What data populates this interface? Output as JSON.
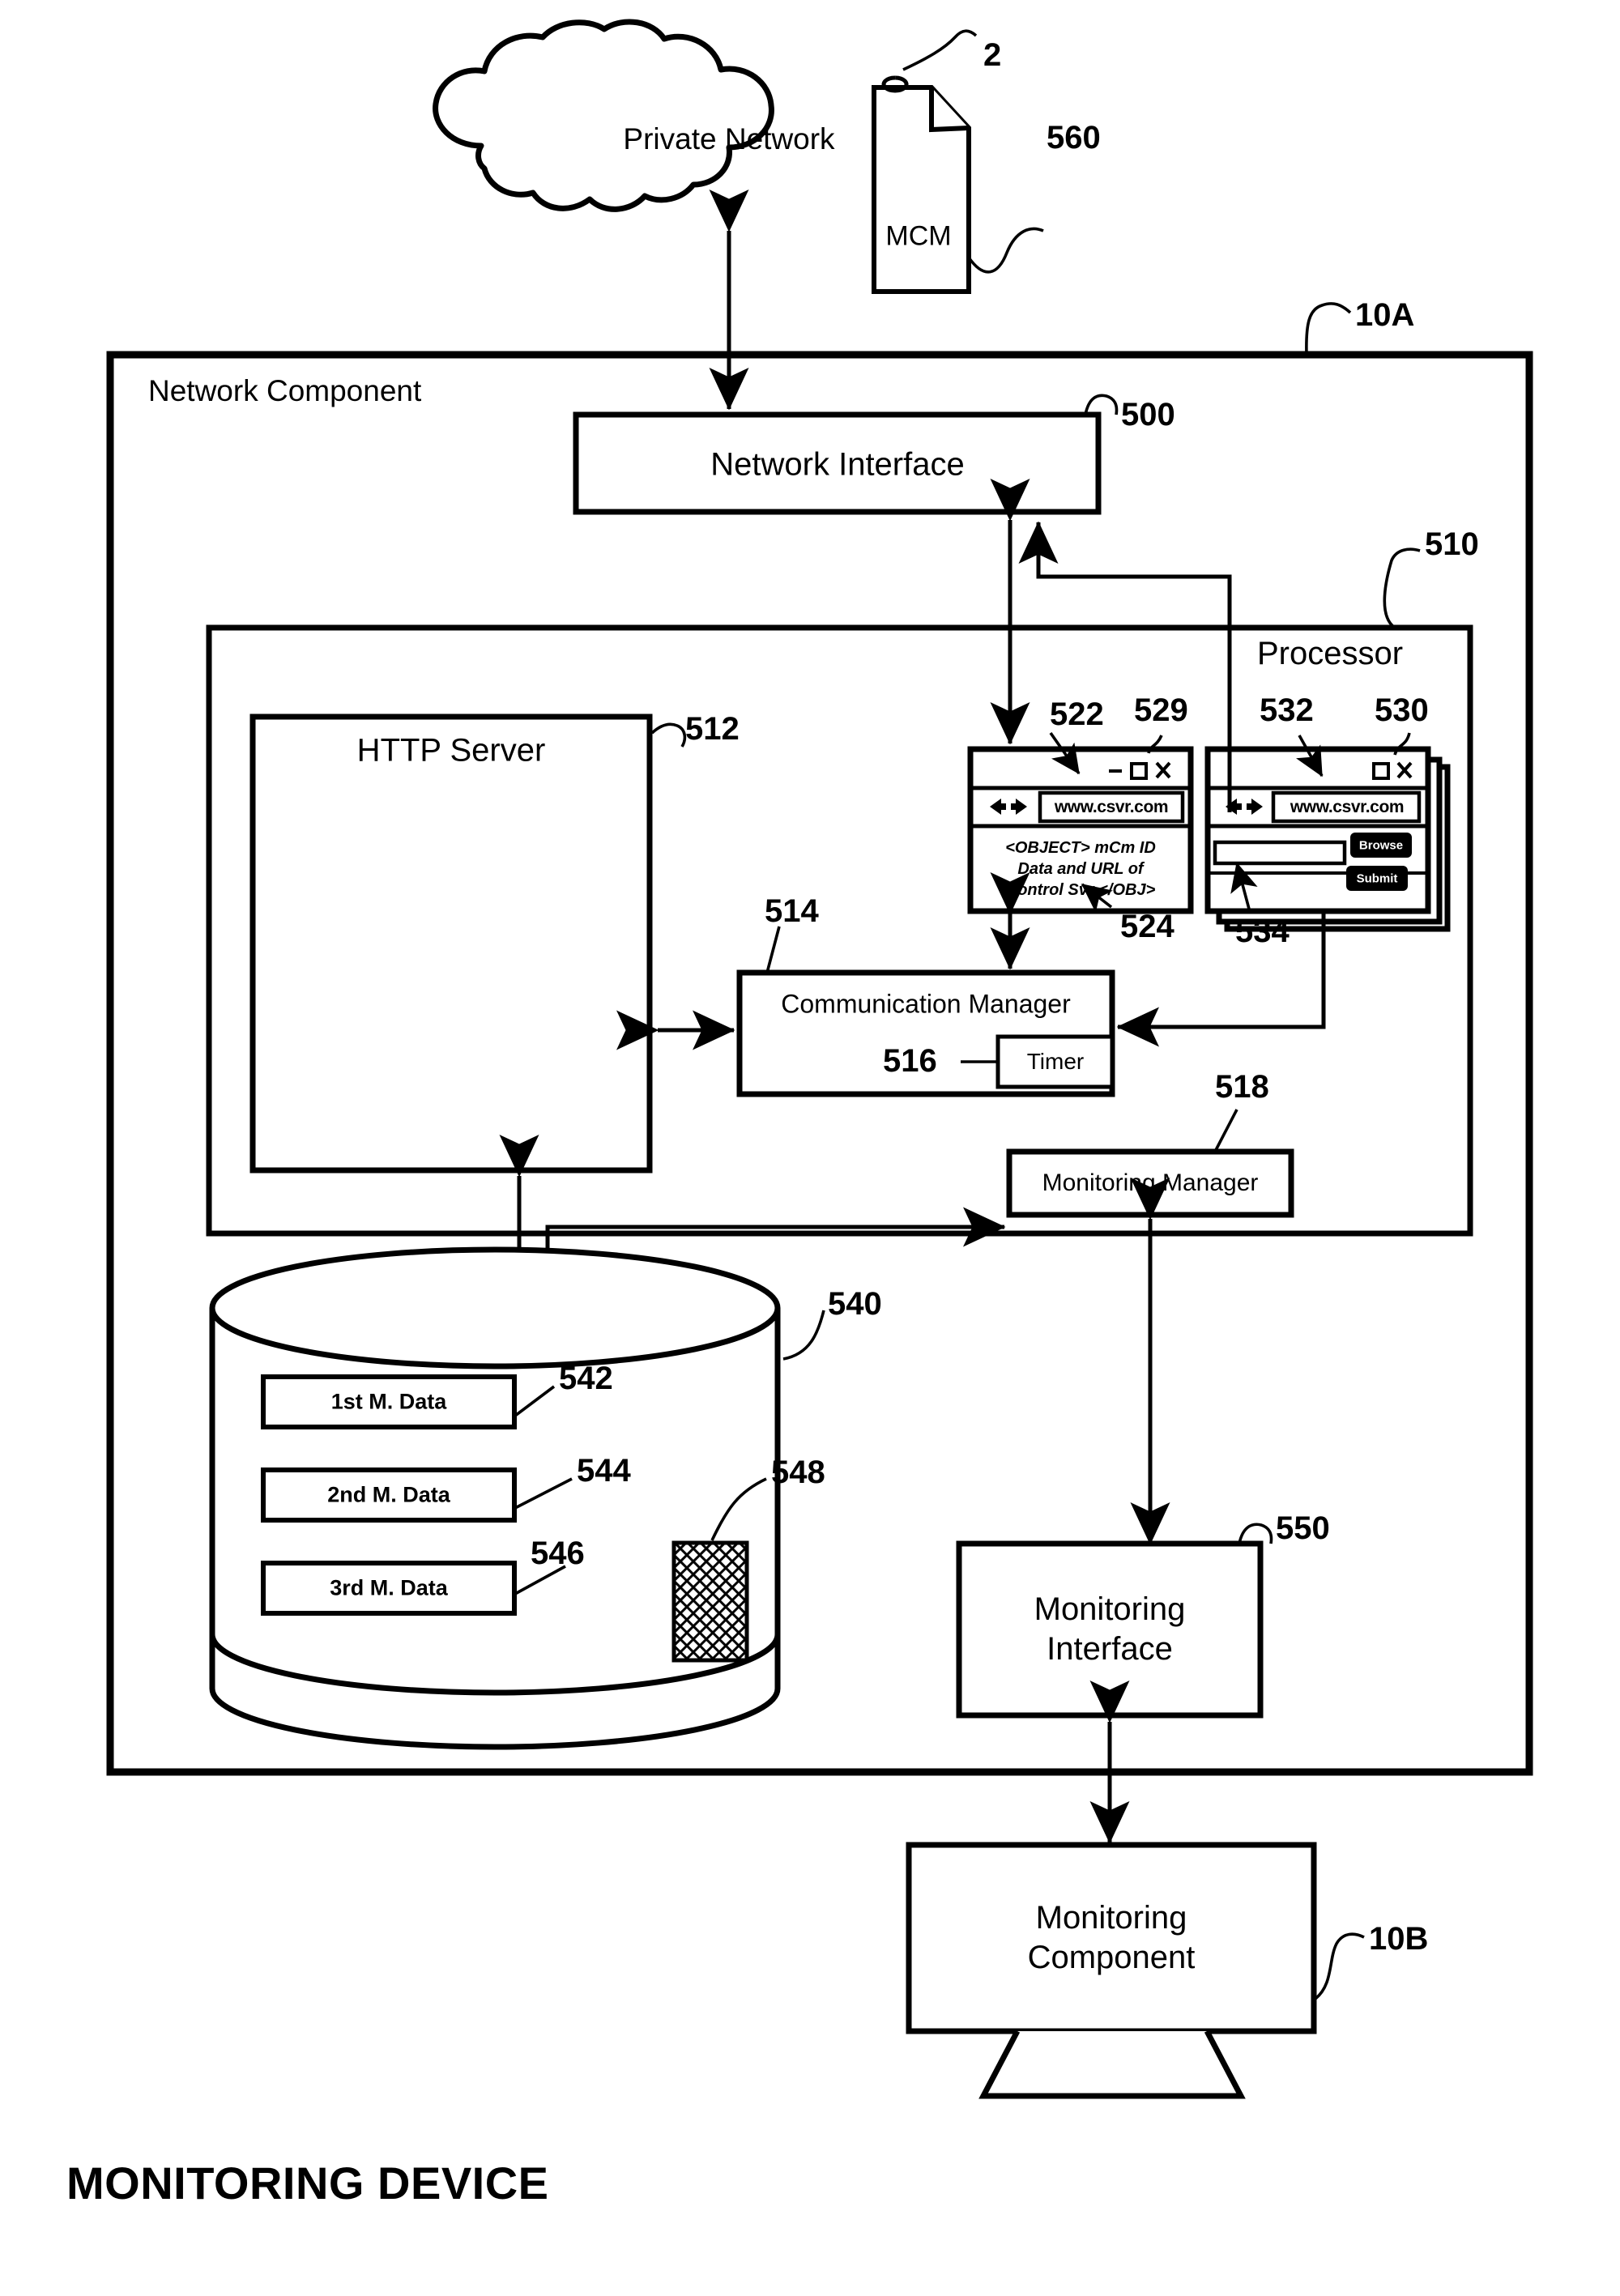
{
  "figure": {
    "caption": "MONITORING DEVICE"
  },
  "cloud": {
    "label": "Private Network",
    "ref": "2"
  },
  "mcm_document": {
    "label": "MCM",
    "ref": "560"
  },
  "network_component": {
    "title": "Network Component",
    "ref": "10A"
  },
  "network_interface": {
    "label": "Network Interface",
    "ref": "500"
  },
  "processor": {
    "label": "Processor",
    "ref": "510"
  },
  "http_server": {
    "label": "HTTP  Server",
    "ref": "512"
  },
  "communication_manager": {
    "label": "Communication Manager",
    "ref": "514"
  },
  "timer": {
    "label": "Timer",
    "ref": "516"
  },
  "monitoring_manager": {
    "label": "Monitoring Manager",
    "ref": "518"
  },
  "browser_522": {
    "ref_window": "529",
    "ref_url": "522",
    "ref_content": "524",
    "url": "www.csvr.com",
    "back_icon": "back-arrow-icon",
    "forward_icon": "forward-arrow-icon",
    "minimize_glyph": "–",
    "maximize_glyph": "□",
    "close_glyph": "×",
    "content_line1": "<OBJECT> mCm ID",
    "content_line2": "Data and URL of",
    "content_line3": "Control Svr </OBJ>"
  },
  "browser_530": {
    "ref_window": "530",
    "ref_url": "532",
    "ref_field": "534",
    "url": "www.csvr.com",
    "back_icon": "back-arrow-icon",
    "forward_icon": "forward-arrow-icon",
    "maximize_glyph": "□",
    "close_glyph": "×",
    "button1_label": "Browse",
    "button2_label": "Submit",
    "text_field_value": ""
  },
  "database": {
    "ref": "540",
    "records": [
      {
        "label": "1st M. Data",
        "ref": "542"
      },
      {
        "label": "2nd M. Data",
        "ref": "544"
      },
      {
        "label": "3rd M. Data",
        "ref": "546"
      }
    ],
    "hatched_ref": "548"
  },
  "monitoring_interface": {
    "line1": "Monitoring",
    "line2": "Interface",
    "ref": "550"
  },
  "monitoring_component": {
    "line1": "Monitoring",
    "line2": "Component",
    "ref": "10B"
  },
  "colors": {
    "stroke": "#000000",
    "background": "#ffffff"
  }
}
